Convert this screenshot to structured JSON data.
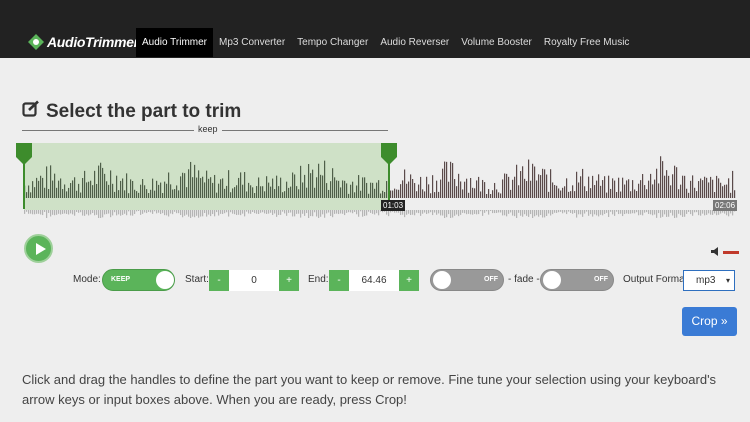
{
  "brand": {
    "name": "AudioTrimmer"
  },
  "nav": {
    "items": [
      "Audio Trimmer",
      "Mp3 Converter",
      "Tempo Changer",
      "Audio Reverser",
      "Volume Booster",
      "Royalty Free Music"
    ]
  },
  "page_title": "Select the part to trim",
  "selection_label": "keep",
  "waveform": {
    "selection_end_time": "01:03",
    "duration": "02:06"
  },
  "controls": {
    "mode_label": "Mode:",
    "mode_value": "KEEP",
    "start_label": "Start:",
    "start_value": "0",
    "end_label": "End:",
    "end_value": "64.46",
    "minus": "-",
    "plus": "+",
    "fade_in_value": "OFF",
    "fade_label": "- fade -",
    "fade_out_value": "OFF",
    "format_label": "Output Format",
    "format_value": "mp3",
    "crop_label": "Crop »"
  },
  "instructions": "Click and drag the handles to define the part you want to keep or remove. Fine tune your selection using your keyboard's arrow keys or input boxes above. When you are ready, press Crop!",
  "colors": {
    "accent": "#5bb45a",
    "crop": "#3a7bd5",
    "nav_bg": "#222222"
  }
}
